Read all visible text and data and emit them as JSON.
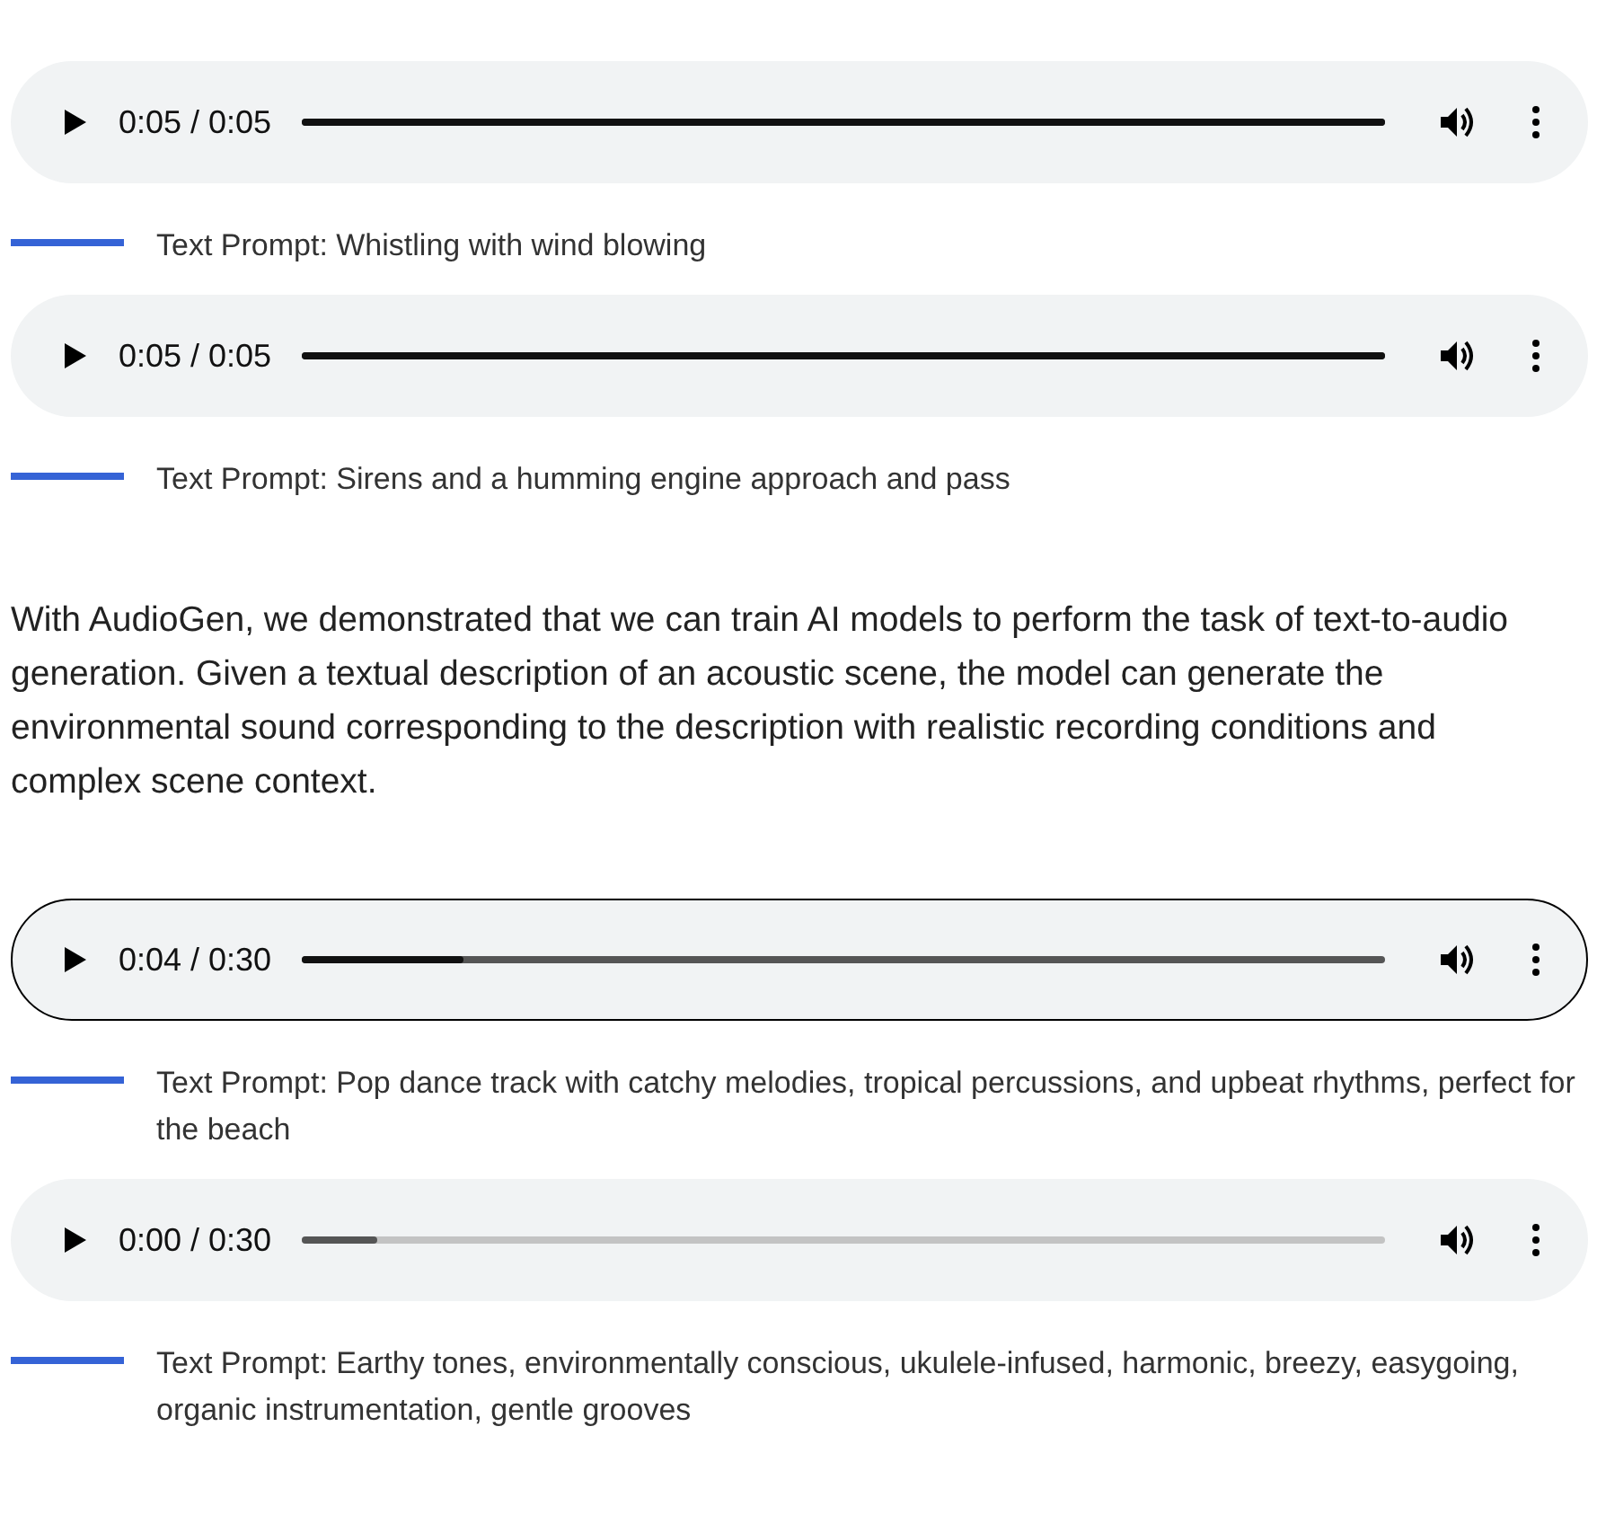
{
  "blocks": [
    {
      "kind": "player",
      "time": "0:05 / 0:05",
      "level": 1,
      "buffered": true,
      "focused": false
    },
    {
      "kind": "caption",
      "text": "Text Prompt: Whistling with wind blowing"
    },
    {
      "kind": "player",
      "time": "0:05 / 0:05",
      "level": 1,
      "buffered": true,
      "focused": false
    },
    {
      "kind": "caption",
      "text": "Text Prompt: Sirens and a humming engine approach and pass"
    },
    {
      "kind": "paragraph",
      "text": "With AudioGen, we demonstrated that we can train AI models to perform the task of text-to-audio generation. Given a textual description of an acoustic scene, the model can generate the environmental sound corresponding to the description with realistic recording conditions and complex scene context."
    },
    {
      "kind": "player",
      "time": "0:04 / 0:30",
      "level": 0.15,
      "buffered": true,
      "focused": true
    },
    {
      "kind": "caption",
      "text": "Text Prompt: Pop dance track with catchy melodies, tropical percussions, and upbeat rhythms, perfect for the beach"
    },
    {
      "kind": "player",
      "time": "0:00 / 0:30",
      "level": 0.07,
      "buffered": false,
      "focused": false
    },
    {
      "kind": "caption",
      "text": "Text Prompt: Earthy tones, environmentally conscious, ukulele-infused, harmonic, breezy, easygoing, organic instrumentation, gentle grooves"
    }
  ]
}
